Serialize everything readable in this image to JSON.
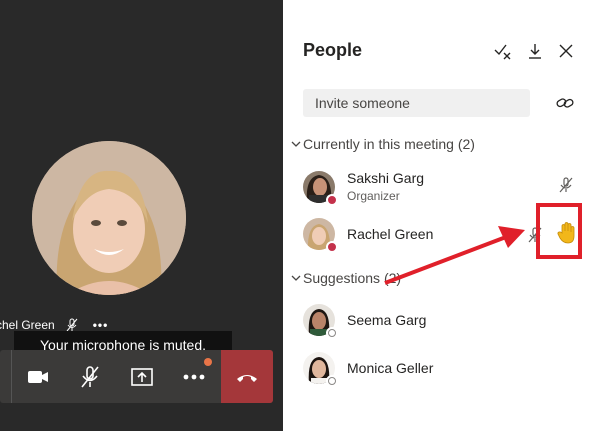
{
  "stage": {
    "participant_name": "chel Green",
    "tooltip": "Your microphone is muted.",
    "more_dots": "•••"
  },
  "panel": {
    "title": "People",
    "invite_placeholder": "Invite someone",
    "section_in_meeting": "Currently in this meeting (2)",
    "section_suggestions": "Suggestions (2)",
    "in_meeting": [
      {
        "name": "Sakshi Garg",
        "role": "Organizer"
      },
      {
        "name": "Rachel Green",
        "role": ""
      }
    ],
    "suggestions": [
      {
        "name": "Seema Garg"
      },
      {
        "name": "Monica Geller"
      }
    ]
  },
  "colors": {
    "accent_red": "#e0202a",
    "hangup": "#a4373a",
    "busy": "#c4314b",
    "hand": "#f2b71a"
  },
  "icons": [
    "camera-icon",
    "mic-off-icon",
    "share-icon",
    "more-icon",
    "hangup-icon",
    "mute-all-icon",
    "download-icon",
    "close-icon",
    "link-icon",
    "raised-hand-icon"
  ]
}
